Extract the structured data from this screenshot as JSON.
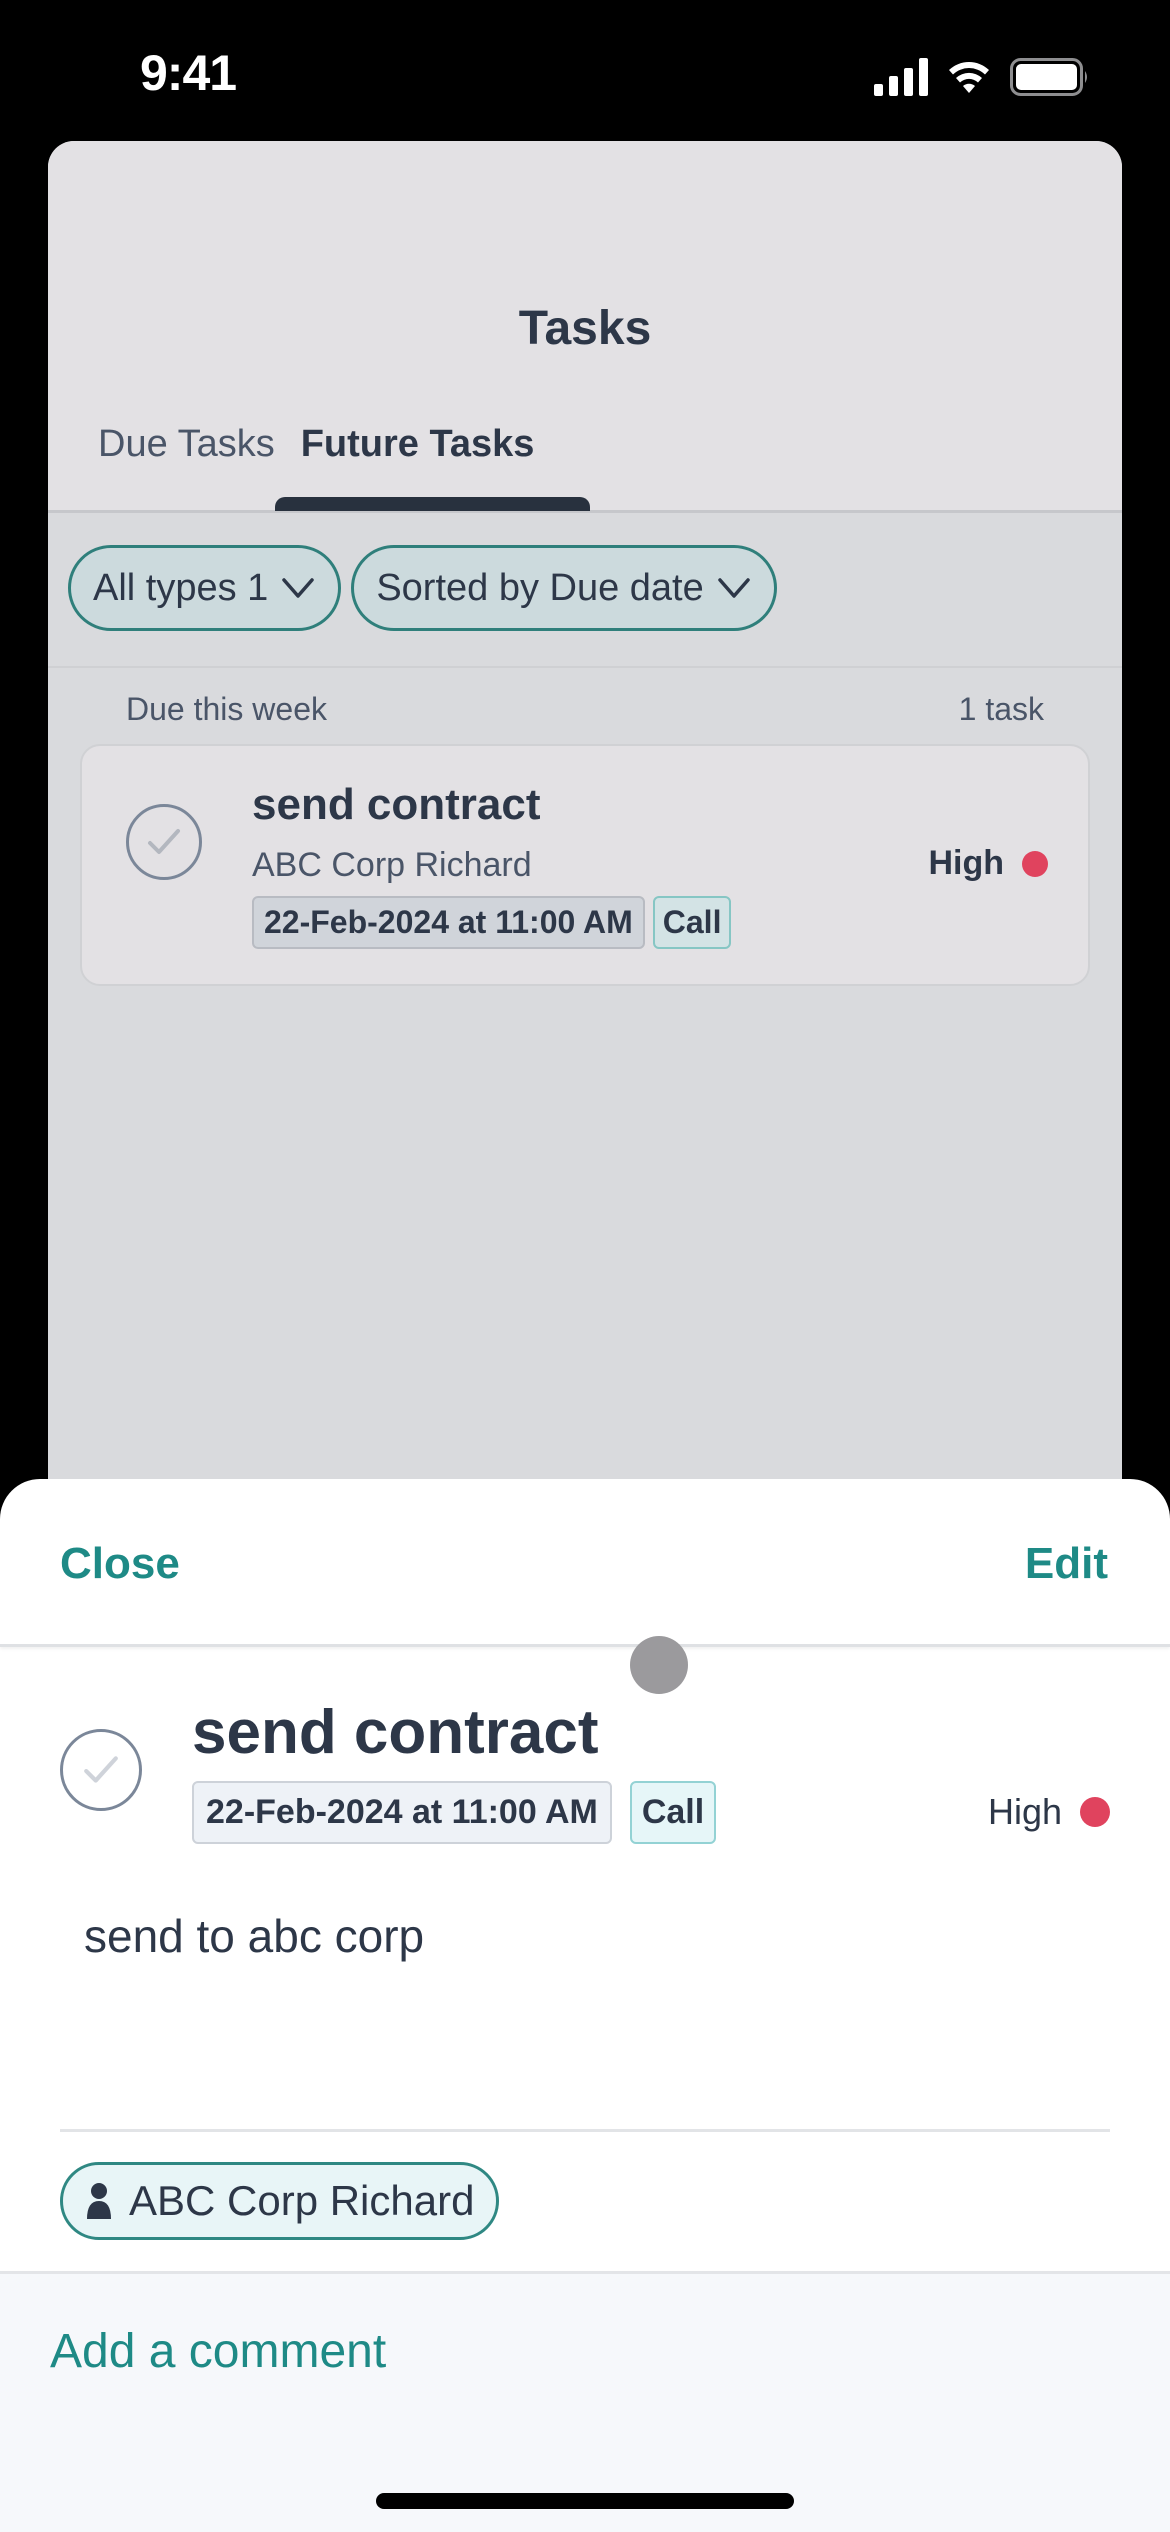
{
  "status_bar": {
    "time": "9:41",
    "icons": [
      "cellular-signal-icon",
      "wifi-icon",
      "battery-icon"
    ]
  },
  "background_screen": {
    "title": "Tasks",
    "tabs": [
      {
        "label": "Due Tasks",
        "active": false
      },
      {
        "label": "Future Tasks",
        "active": true
      }
    ],
    "filters": [
      {
        "label": "All types 1",
        "icon": "chevron-down-icon"
      },
      {
        "label": "Sorted by Due date",
        "icon": "chevron-down-icon"
      }
    ],
    "section": {
      "label": "Due this week",
      "count": "1 task"
    },
    "task": {
      "title": "send contract",
      "contact": "ABC Corp Richard",
      "due": "22-Feb-2024 at 11:00 AM",
      "type": "Call",
      "priority": "High"
    }
  },
  "modal": {
    "close_label": "Close",
    "edit_label": "Edit",
    "task": {
      "title": "send contract",
      "due": "22-Feb-2024 at 11:00 AM",
      "type": "Call",
      "priority": "High",
      "description": "send to abc corp",
      "association": "ABC Corp Richard"
    },
    "comment_placeholder": "Add a comment"
  },
  "colors": {
    "accent": "#1e8a86",
    "priority_high": "#e0435e",
    "text_primary": "#2d3748"
  }
}
